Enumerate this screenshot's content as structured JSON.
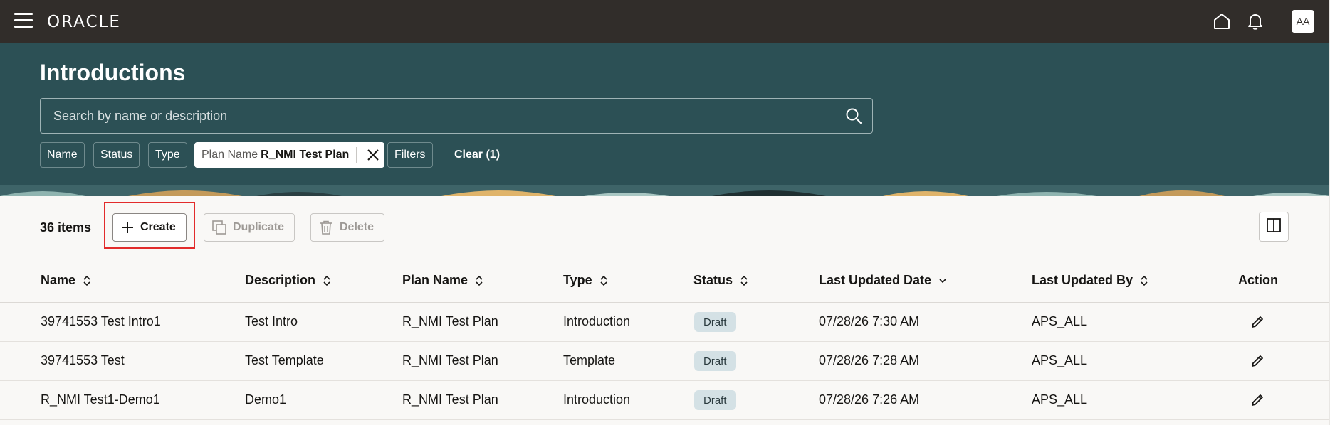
{
  "app": {
    "logo": "ORACLE",
    "avatar_initials": "AA"
  },
  "top_icons": [
    "home-icon",
    "bell-icon"
  ],
  "page": {
    "title": "Introductions"
  },
  "search": {
    "placeholder": "Search by name or description"
  },
  "filters": {
    "chips": [
      "Name",
      "Status",
      "Type"
    ],
    "active_chip": {
      "key": "Plan Name",
      "value": "R_NMI Test Plan"
    },
    "filters_label": "Filters",
    "clear_label": "Clear (1)"
  },
  "toolbar": {
    "items_count": "36 items",
    "create_label": "Create",
    "duplicate_label": "Duplicate",
    "delete_label": "Delete"
  },
  "table": {
    "columns": [
      "Name",
      "Description",
      "Plan Name",
      "Type",
      "Status",
      "Last Updated Date",
      "Last Updated By",
      "Action"
    ],
    "rows": [
      {
        "name": "39741553 Test Intro1",
        "description": "Test Intro",
        "plan_name": "R_NMI Test Plan",
        "type": "Introduction",
        "status": "Draft",
        "last_updated_date": "07/28/26 7:30 AM",
        "last_updated_by": "APS_ALL"
      },
      {
        "name": "39741553 Test",
        "description": "Test Template",
        "plan_name": "R_NMI Test Plan",
        "type": "Template",
        "status": "Draft",
        "last_updated_date": "07/28/26 7:28 AM",
        "last_updated_by": "APS_ALL"
      },
      {
        "name": "R_NMI Test1-Demo1",
        "description": "Demo1",
        "plan_name": "R_NMI Test Plan",
        "type": "Introduction",
        "status": "Draft",
        "last_updated_date": "07/28/26 7:26 AM",
        "last_updated_by": "APS_ALL"
      }
    ]
  },
  "colors": {
    "header_bg": "#2c5055",
    "topbar_bg": "#312d2a",
    "badge_bg": "#d4e1e5",
    "highlight": "#e22b2b"
  }
}
